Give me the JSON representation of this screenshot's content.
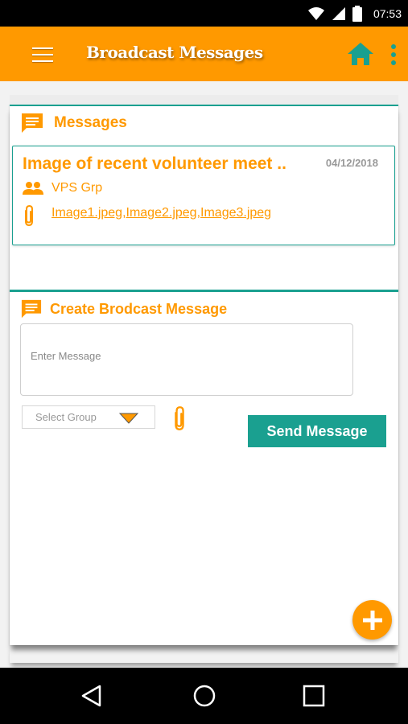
{
  "status_bar": {
    "time": "07:53",
    "icons": [
      "wifi-icon",
      "signal-icon",
      "battery-icon"
    ]
  },
  "app_bar": {
    "title": "Broadcast Messages",
    "icons": [
      "menu-icon",
      "home-icon",
      "more-vert-icon"
    ],
    "colors": {
      "background": "#ff9900",
      "accent": "#1aa090"
    }
  },
  "messages_section": {
    "heading": "Messages",
    "items": [
      {
        "title": "Image of recent volunteer meet ..",
        "date": "04/12/2018",
        "group": "VPS Grp",
        "attachments": "Image1.jpeg,Image2.jpeg,Image3.jpeg"
      }
    ]
  },
  "create_section": {
    "heading": "Create Brodcast Message",
    "message_placeholder": "Enter Message",
    "group_placeholder": "Select Group",
    "send_label": "Send Message"
  },
  "fab": {
    "icon": "add-icon"
  },
  "nav_bar": {
    "buttons": [
      "back-icon",
      "home-circle-icon",
      "recents-icon"
    ]
  }
}
